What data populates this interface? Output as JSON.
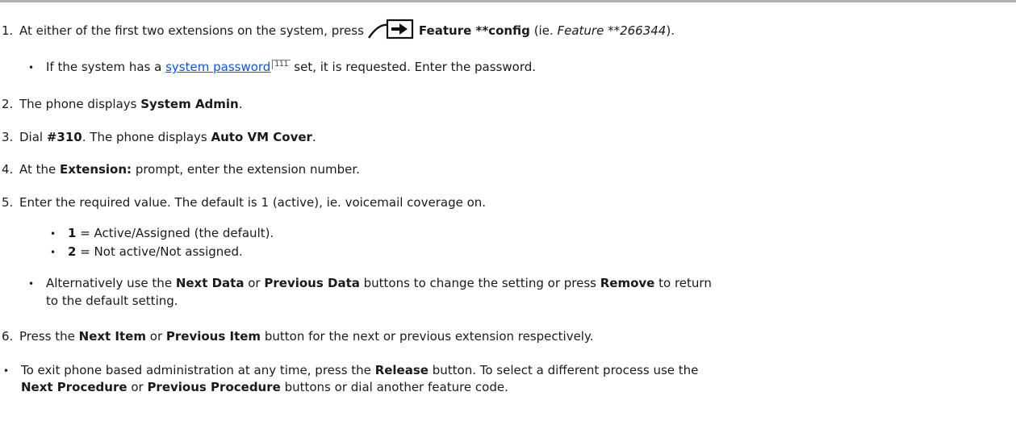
{
  "steps": [
    {
      "num": "1.",
      "pre": "At either of the first two extensions on the system, press",
      "b1": "Feature **config",
      "mid": " (ie. ",
      "ital": "Feature **266344",
      "post": ")."
    },
    {
      "num": "2.",
      "pre": "The phone displays ",
      "b1": "System Admin",
      "post": "."
    },
    {
      "num": "3.",
      "pre": "Dial ",
      "b1": "#310",
      "mid": ". The phone displays ",
      "b2": "Auto VM Cover",
      "post": "."
    },
    {
      "num": "4.",
      "pre": "At the ",
      "b1": "Extension:",
      "post": " prompt, enter the extension number."
    },
    {
      "num": "5.",
      "text": "Enter the required value. The default is 1 (active), ie. voicemail coverage on."
    },
    {
      "num": "6.",
      "pre": "Press the ",
      "b1": "Next Item",
      "mid": " or ",
      "b2": "Previous Item",
      "post": " button for the next or previous extension respectively."
    }
  ],
  "password_note": {
    "pre": "If the system has a ",
    "link": "system password",
    "pageref": "111",
    "post": " set, it is requested. Enter the password."
  },
  "values": [
    {
      "key": "1",
      "desc": " = Active/Assigned (the default)."
    },
    {
      "key": "2",
      "desc": " = Not active/Not assigned."
    }
  ],
  "alt_note": {
    "pre": "Alternatively use the ",
    "b1": "Next Data",
    "mid1": " or ",
    "b2": "Previous Data",
    "mid2": " buttons to change the setting or press ",
    "b3": "Remove",
    "post": " to return",
    "line2": "to the default setting."
  },
  "exit_note": {
    "pre": "To exit phone based administration at any time, press the ",
    "b1": "Release",
    "mid": " button. To select a different process use the",
    "b2": "Next Procedure",
    "mid2": " or ",
    "b3": "Previous Procedure",
    "post": " buttons or dial another feature code."
  },
  "bullet": "•"
}
